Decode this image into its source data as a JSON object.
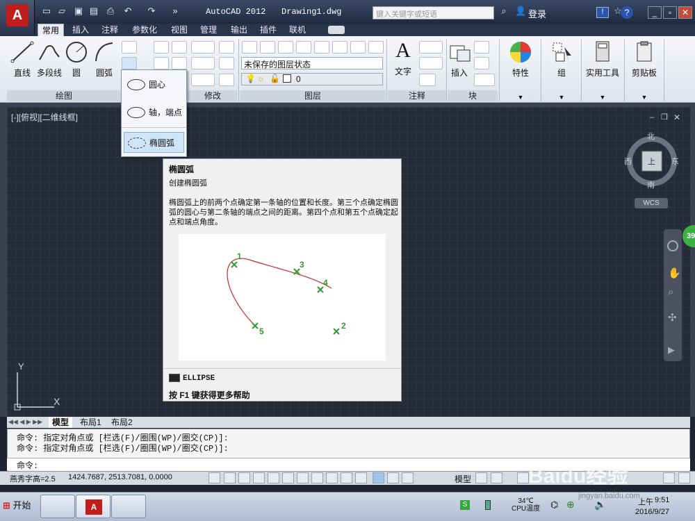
{
  "titlebar": {
    "app_title": "AutoCAD 2012",
    "doc_title": "Drawing1.dwg",
    "search_placeholder": "键入关键字或短语",
    "login": "登录"
  },
  "tabs": [
    {
      "label": "常用",
      "active": true
    },
    {
      "label": "插入"
    },
    {
      "label": "注释"
    },
    {
      "label": "参数化"
    },
    {
      "label": "视图"
    },
    {
      "label": "管理"
    },
    {
      "label": "输出"
    },
    {
      "label": "插件"
    },
    {
      "label": "联机"
    }
  ],
  "draw_panel": {
    "title": "绘图",
    "line": "直线",
    "polyline": "多段线",
    "circle": "圆",
    "arc": "圆弧"
  },
  "modify_panel": {
    "title": "修改"
  },
  "layers_panel": {
    "title": "图层",
    "layer_state": "未保存的图层状态",
    "current_layer": "0"
  },
  "annotation_panel": {
    "title": "注释",
    "text": "文字"
  },
  "block_panel": {
    "title": "块",
    "insert": "插入"
  },
  "properties_btn": "特性",
  "group_btn": "组",
  "utilities_btn": "实用工具",
  "clipboard_btn": "剪贴板",
  "ellipse_menu": {
    "items": [
      "圆心",
      "轴，端点",
      "椭圆弧"
    ],
    "selected_index": 2
  },
  "viewport_label": "[-][俯视][二维线框]",
  "viewcube": {
    "north": "北",
    "south": "南",
    "east": "东",
    "west": "西",
    "top": "上",
    "wcs": "WCS"
  },
  "tooltip": {
    "title": "椭圆弧",
    "subtitle": "创建椭圆弧",
    "description": "椭圆弧上的前两个点确定第一条轴的位置和长度。第三个点确定椭圆弧的圆心与第二条轴的端点之间的距离。第四个点和第五个点确定起点和端点角度。",
    "points": [
      "1",
      "2",
      "3",
      "4",
      "5"
    ],
    "command": "ELLIPSE",
    "help": "按 F1 键获得更多帮助"
  },
  "ucs": {
    "x": "X",
    "y": "Y"
  },
  "badge": "39",
  "layout_tabs": [
    "模型",
    "布局1",
    "布局2"
  ],
  "command_lines": [
    "命令: 指定对角点或 [栏选(F)/圈围(WP)/圈交(CP)]:",
    "命令: 指定对角点或 [栏选(F)/圈围(WP)/圈交(CP)]:"
  ],
  "command_prompt": "命令:",
  "status": {
    "font_label": "燕秀字高=2.5",
    "coordinates": "1424.7687, 2513.7081, 0.0000",
    "model_btn": "模型"
  },
  "taskbar": {
    "start": "开始",
    "cpu_temp": "34℃",
    "cpu_label": "CPU温度",
    "time": "9:51",
    "date": "2016/9/27",
    "ampm": "上午"
  },
  "watermark": {
    "main": "Baidu经验",
    "url": "jingyan.baidu.com"
  }
}
